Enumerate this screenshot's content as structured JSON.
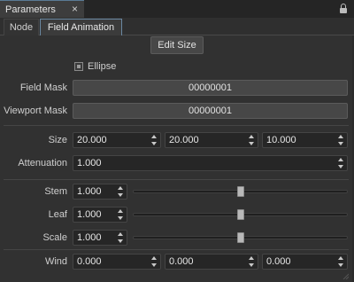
{
  "window": {
    "tab_title": "Parameters",
    "close_glyph": "×"
  },
  "tabs": [
    {
      "label": "Node"
    },
    {
      "label": "Field Animation"
    }
  ],
  "buttons": {
    "edit_size": "Edit Size"
  },
  "ellipse": {
    "label": "Ellipse",
    "checked": true
  },
  "field_mask": {
    "label": "Field Mask",
    "value": "00000001"
  },
  "viewport_mask": {
    "label": "Viewport Mask",
    "value": "00000001"
  },
  "size": {
    "label": "Size",
    "values": [
      "20.000",
      "20.000",
      "10.000"
    ]
  },
  "attenuation": {
    "label": "Attenuation",
    "value": "1.000"
  },
  "stem": {
    "label": "Stem",
    "value": "1.000",
    "slider_level": 0.5
  },
  "leaf": {
    "label": "Leaf",
    "value": "1.000",
    "slider_level": 0.5
  },
  "scale": {
    "label": "Scale",
    "value": "1.000",
    "slider_level": 0.5
  },
  "wind": {
    "label": "Wind",
    "values": [
      "0.000",
      "0.000",
      "0.000"
    ]
  },
  "icons": {
    "lock": "lock-icon",
    "close": "close-icon",
    "resize": "resize-grip-icon"
  }
}
